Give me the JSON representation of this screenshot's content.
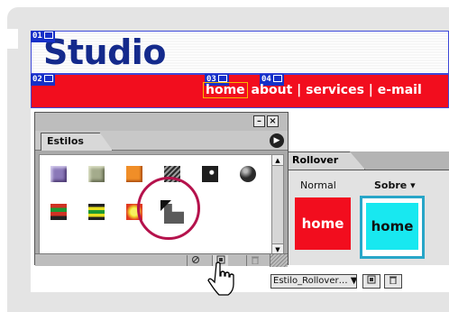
{
  "document": {
    "title": "Studio",
    "slices": [
      "01",
      "02",
      "03",
      "04"
    ],
    "nav": {
      "home": "home",
      "rest": " about | services | e-mail"
    }
  },
  "styles_panel": {
    "tab_label": "Estilos",
    "window_buttons": [
      "minimize-icon",
      "close-icon"
    ],
    "menu_icon": "panel-menu-arrow-icon",
    "swatches": [
      {
        "name": "purple-bevel",
        "color": "#8a78b8"
      },
      {
        "name": "sage-bevel",
        "color": "#a4ab8c"
      },
      {
        "name": "orange-square",
        "color": "#f08e28"
      },
      {
        "name": "brushed-metal",
        "color": "#6b6b6b"
      },
      {
        "name": "dark-cd",
        "color": "#1e1e1e"
      },
      {
        "name": "black-sphere",
        "color": "#2a2a2a"
      },
      {
        "name": "striped-red-green",
        "color": "#d13224"
      },
      {
        "name": "striped-yellow",
        "color": "#e8e020"
      },
      {
        "name": "yellow-red-glow",
        "color": "#f2e430"
      },
      {
        "name": "new-style-placeholder",
        "color": "#5a5a5a"
      }
    ],
    "bottom_buttons": [
      "clear-style-icon",
      "new-style-icon",
      "trash-icon"
    ]
  },
  "rollover_panel": {
    "tab_label": "Rollover",
    "normal_label": "Normal",
    "over_label": "Sobre ▾",
    "normal_button_text": "home",
    "over_button_text": "home",
    "state_combo": "Estilo_Rollover… ▼"
  },
  "colors": {
    "title_blue": "#142a8c",
    "nav_red": "#f20d1e",
    "over_cyan": "#18e8f0",
    "highlight_circle": "#b5124c"
  }
}
